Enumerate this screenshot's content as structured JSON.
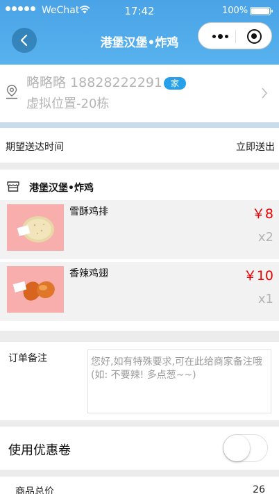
{
  "status_bar": {
    "carrier": "WeChat",
    "time": "17:42",
    "battery": "100%"
  },
  "nav": {
    "title": "港堡汉堡•炸鸡"
  },
  "address": {
    "contact": "略略略 18828222291",
    "tag": "家",
    "location": "虚拟位置-20栋"
  },
  "delivery": {
    "label": "期望送达时间",
    "value": "立即送出"
  },
  "store": {
    "name": "港堡汉堡•炸鸡",
    "items": [
      {
        "name": "雪酥鸡排",
        "price": "￥8",
        "qty": "x2"
      },
      {
        "name": "香辣鸡翅",
        "price": "￥10",
        "qty": "x1"
      }
    ]
  },
  "remark": {
    "label": "订单备注",
    "placeholder": "您好,如有特殊要求,可在此给商家备注哦 (如: 不要辣! 多点葱~~)"
  },
  "coupon": {
    "label": "使用优惠卷",
    "enabled": false
  },
  "subtotal": {
    "label": "商品总价",
    "value": "26"
  },
  "colors": {
    "nav_blue": "#4aa3e6",
    "tag_blue": "#27a0ea",
    "price_red": "#e00000"
  }
}
